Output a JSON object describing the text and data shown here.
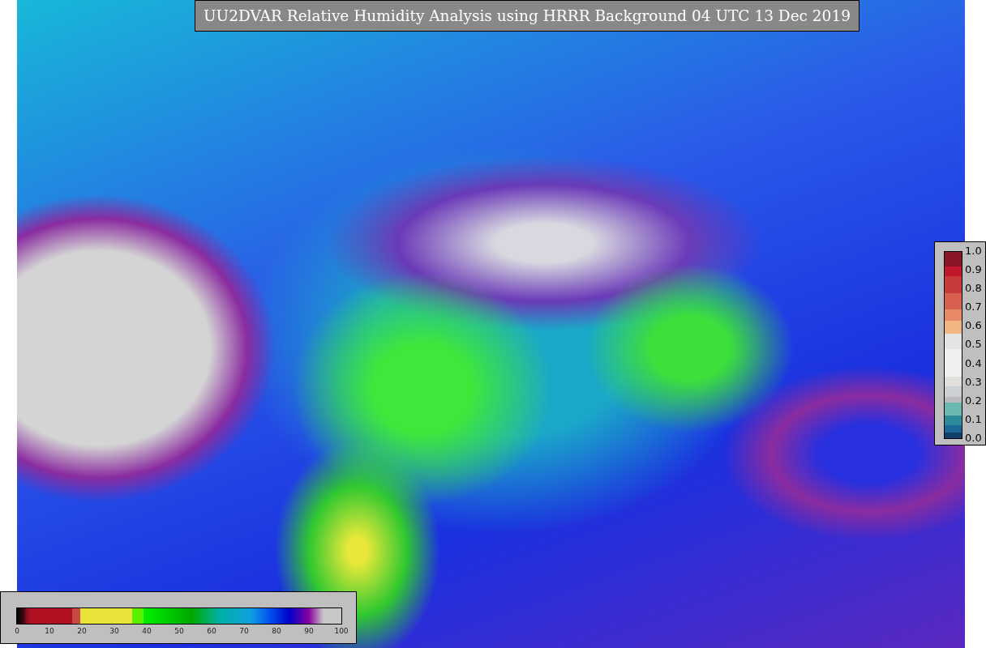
{
  "title": "UU2DVAR Relative Humidity Analysis using HRRR Background 04 UTC 13 Dec 2019",
  "colorbars": [
    {
      "kind": "vertical",
      "ticks": [
        "1.0",
        "0.9",
        "0.8",
        "0.7",
        "0.6",
        "0.5",
        "0.4",
        "0.3",
        "0.2",
        "0.1",
        "0.0"
      ]
    },
    {
      "kind": "horizontal",
      "ticks": [
        "0",
        "10",
        "20",
        "30",
        "40",
        "50",
        "60",
        "70",
        "80",
        "90",
        "100"
      ]
    }
  ]
}
